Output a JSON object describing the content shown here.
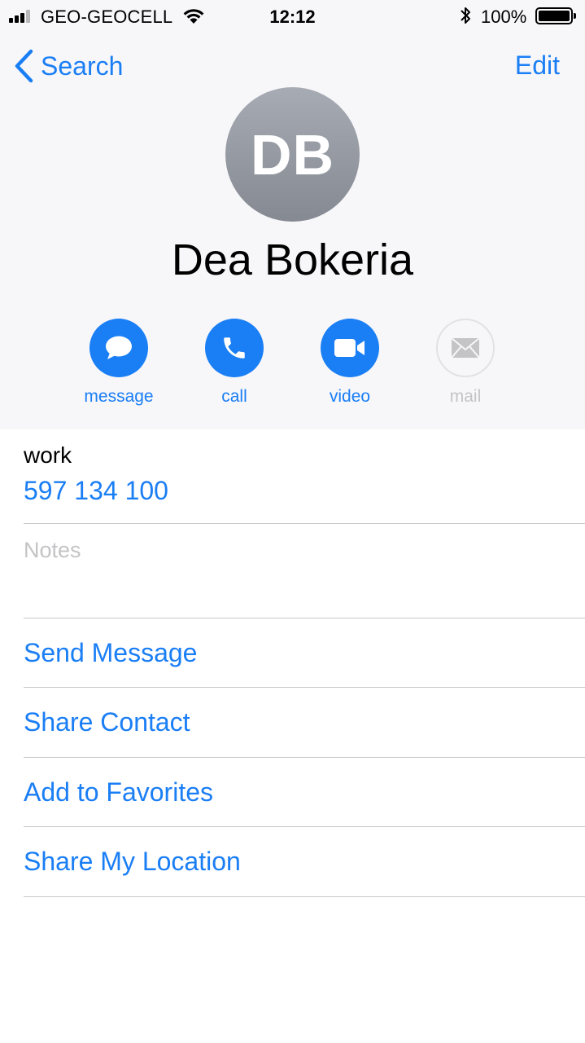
{
  "status_bar": {
    "carrier": "GEO-GEOCELL",
    "time": "12:12",
    "battery_pct": "100%"
  },
  "nav": {
    "back_label": "Search",
    "edit_label": "Edit"
  },
  "contact": {
    "initials": "DB",
    "name": "Dea Bokeria"
  },
  "actions": [
    {
      "label": "message",
      "icon": "message-bubble-icon",
      "enabled": true
    },
    {
      "label": "call",
      "icon": "phone-icon",
      "enabled": true
    },
    {
      "label": "video",
      "icon": "video-camera-icon",
      "enabled": true
    },
    {
      "label": "mail",
      "icon": "envelope-icon",
      "enabled": false
    }
  ],
  "phone": {
    "label": "work",
    "value": "597 134 100"
  },
  "notes": {
    "label": "Notes"
  },
  "links": [
    {
      "label": "Send Message"
    },
    {
      "label": "Share Contact"
    },
    {
      "label": "Add to Favorites"
    },
    {
      "label": "Share My Location"
    }
  ],
  "colors": {
    "accent": "#1a7ef5",
    "header_bg": "#f7f7f9",
    "disabled": "#c4c4c6",
    "separator": "#c8c7cc"
  }
}
